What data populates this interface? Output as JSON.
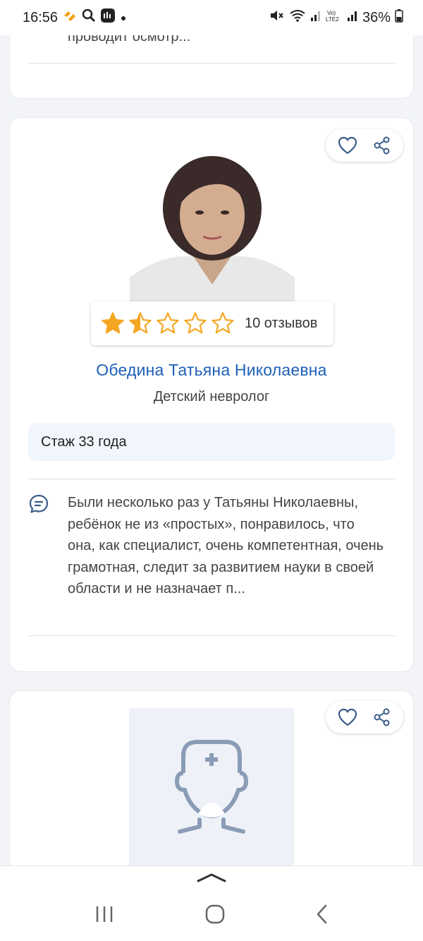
{
  "status_bar": {
    "time": "16:56",
    "battery": "36%"
  },
  "card_prev": {
    "snippet_end": "проводит осмотр..."
  },
  "card_doctor": {
    "reviews_count": "10 отзывов",
    "rating": 1.5,
    "rating_max": 5,
    "name": "Обедина Татьяна Николаевна",
    "specialty": "Детский невролог",
    "experience": "Стаж 33 года",
    "review_snippet": "Были несколько раз у Татьяны Николаевны, ребёнок не из «простых», понравилось, что она, как специалист, очень компетентная, очень грамотная, следит за развитием науки в своей области и не назначает п..."
  },
  "colors": {
    "accent_blue": "#1d5fb8",
    "star": "#f5a623",
    "icon_blue": "#3b5c8a",
    "placeholder": "#8a9cb6"
  },
  "icons": {
    "favorite": "heart-icon",
    "share": "share-icon",
    "review": "comment-icon",
    "doctor_placeholder": "doctor-avatar-icon",
    "collapse": "chevron-up-icon",
    "nav_recents": "recents-icon",
    "nav_home": "home-icon",
    "nav_back": "back-icon"
  }
}
